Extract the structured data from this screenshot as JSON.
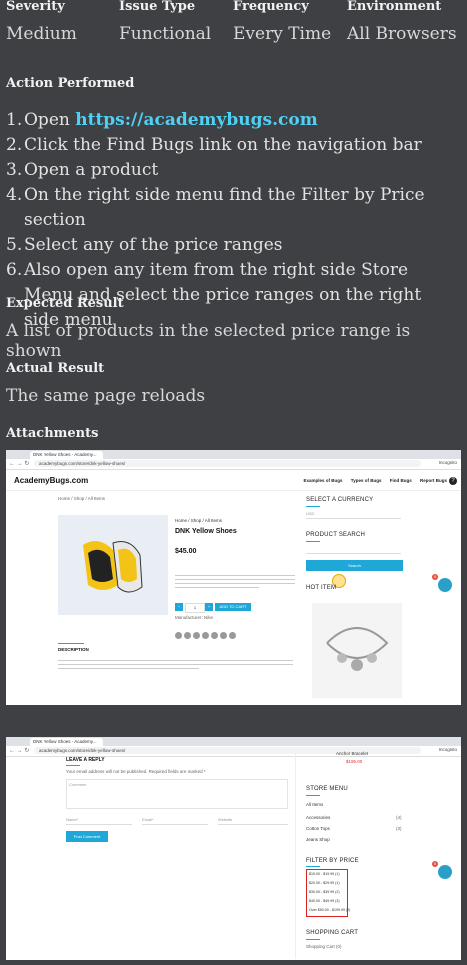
{
  "header": {
    "labels": [
      "Severity",
      "Issue Type",
      "Frequency",
      "Environment"
    ],
    "values": [
      "Medium",
      "Functional",
      "Every Time",
      "All Browsers"
    ]
  },
  "action": {
    "title": "Action Performed",
    "steps": [
      {
        "num": "1.",
        "text": "Open ",
        "link": "https://academybugs.com"
      },
      {
        "num": "2.",
        "text": "Click the Find Bugs link on the navigation bar"
      },
      {
        "num": "3.",
        "text": "Open a product"
      },
      {
        "num": "4.",
        "text": "On the right side menu find the Filter by Price section"
      },
      {
        "num": "5.",
        "text": "Select any of the price ranges"
      },
      {
        "num": "6.",
        "text": "Also open any item from the right side Store Menu and select the price ranges on the right side menu"
      }
    ]
  },
  "expected": {
    "title": "Expected Result",
    "text": "A list of products in the selected price range is shown"
  },
  "actual": {
    "title": "Actual Result",
    "text": "The same page reloads"
  },
  "attachments": {
    "title": "Attachments"
  },
  "shot1": {
    "tab": "DNK Yellow Shoes - Academy...",
    "url": "academybugs.com/store/dnk-yellow-shoes/",
    "profile": "Incognito",
    "logo": "AcademyBugs.com",
    "nav": [
      "Examples of Bugs",
      "Types of Bugs",
      "Find Bugs",
      "Report Bugs"
    ],
    "breadcrumb": "Home / Shop / All Items",
    "product_breadcrumb": "Home / Shop / All Items",
    "product_title": "DNK Yellow Shoes",
    "price": "$45.00",
    "qty": "1",
    "add_to_cart": "ADD TO CART",
    "manufacturer": "Manufacturer: Nike",
    "description_title": "DESCRIPTION",
    "select_currency": "SELECT A CURRENCY",
    "currency_value": "USD",
    "product_search": "PRODUCT SEARCH",
    "search_btn": "Search",
    "hot_item": "HOT ITEM"
  },
  "shot2": {
    "tab": "DNK Yellow Shoes - Academy...",
    "url": "academybugs.com/store/dnk-yellow-shoes/",
    "profile": "Incognito",
    "leave_reply": "LEAVE A REPLY",
    "reply_note": "Your email address will not be published. Required fields are marked *",
    "comment": "Comment",
    "name": "Name*",
    "email": "Email*",
    "website": "Website",
    "post_comment": "Post Comment",
    "anchor_title": "Anchor Bracelet",
    "anchor_price": "$195.00",
    "store_menu": "STORE MENU",
    "store_items": [
      {
        "label": "All Items",
        "count": ""
      },
      {
        "label": "Accessories",
        "count": "(4)"
      },
      {
        "label": "Cotton Tops",
        "count": "(3)"
      },
      {
        "label": "Jeans Shop",
        "count": ""
      }
    ],
    "filter_by_price": "FILTER BY PRICE",
    "price_ranges": [
      "$15.00 - $19.99 (1)",
      "$20.00 - $29.99 (1)",
      "$30.00 - $39.99 (2)",
      "$40.00 - $49.99 (3)",
      "Over $50.00 - $199.99 (2)"
    ],
    "shopping_cart": "SHOPPING CART",
    "cart_empty": "Shopping Cart (0)"
  }
}
